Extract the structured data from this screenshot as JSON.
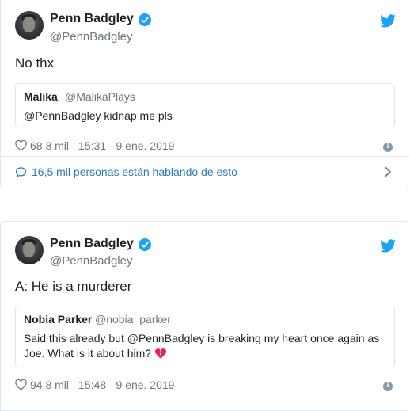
{
  "colors": {
    "verified": "#1da1f2",
    "bird": "#1da1f2",
    "link": "#2b7bb9",
    "muted": "#697882",
    "border": "#e1e8ed",
    "heartbreak": "#e0245e"
  },
  "tweets": [
    {
      "author_name": "Penn Badgley",
      "author_handle": "@PennBadgley",
      "text": "No thx",
      "quote": {
        "name": "Malika",
        "handle": "@MalikaPlays",
        "text": "@PennBadgley kidnap me pls"
      },
      "likes": "68,8 mil",
      "timestamp": "15:31 - 9 ene. 2019",
      "conversation": "16,5 mil personas están hablando de esto"
    },
    {
      "author_name": "Penn Badgley",
      "author_handle": "@PennBadgley",
      "text": "A: He is a murderer",
      "quote": {
        "name": "Nobia Parker",
        "handle": "@nobia_parker",
        "text_line1": "Said this already but @PennBadgley is breaking my heart once again as",
        "text_line2": "Joe. What is it about him?",
        "emoji": "broken-heart-icon"
      },
      "likes": "94,8 mil",
      "timestamp": "15:48 - 9 ene. 2019"
    }
  ]
}
